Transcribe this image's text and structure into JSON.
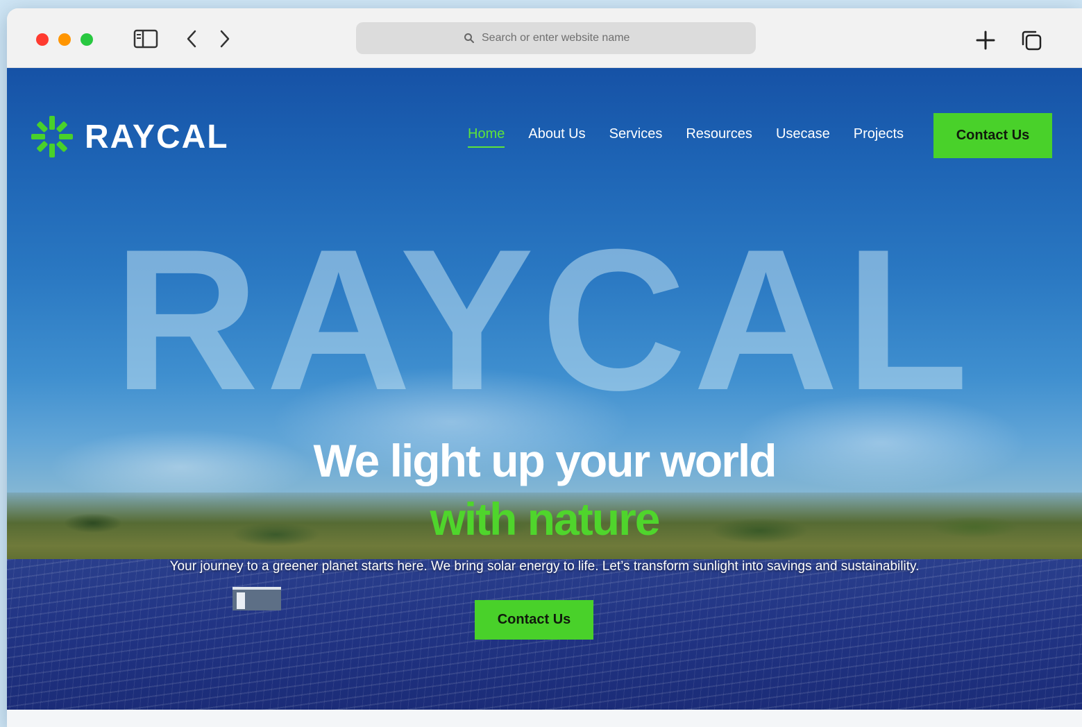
{
  "browser": {
    "address_placeholder": "Search or enter website name"
  },
  "site": {
    "brand": "Raycal",
    "colors": {
      "accent": "#49d12a",
      "accent_text": "#5ee43a",
      "sky": "#1d63b4",
      "white": "#ffffff"
    },
    "nav": [
      {
        "label": "Home",
        "active": true
      },
      {
        "label": "About Us"
      },
      {
        "label": "Services"
      },
      {
        "label": "Resources"
      },
      {
        "label": "Usecase"
      },
      {
        "label": "Projects"
      }
    ],
    "header_cta": "Contact Us"
  },
  "hero": {
    "big_word": "Raycal",
    "headline": "We light up your world",
    "headline_accent": "with nature",
    "tagline": "Your journey to a greener planet starts here. We bring solar energy to life. Let’s transform sunlight into savings and sustainability.",
    "cta": "Contact Us"
  }
}
